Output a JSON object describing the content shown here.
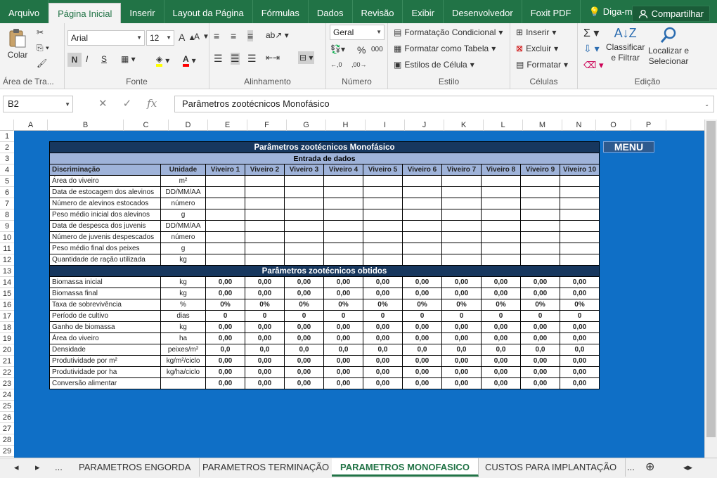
{
  "ribbon_tabs": [
    "Arquivo",
    "Página Inicial",
    "Inserir",
    "Layout da Página",
    "Fórmulas",
    "Dados",
    "Revisão",
    "Exibir",
    "Desenvolvedor",
    "Foxit PDF"
  ],
  "tell_me": "Diga-me...",
  "share": "Compartilhar",
  "clipboard": {
    "paste": "Colar",
    "label": "Área de Tra..."
  },
  "font": {
    "name": "Arial",
    "size": "12",
    "label": "Fonte",
    "bold": "N",
    "italic": "I",
    "underline": "S"
  },
  "alignment": {
    "label": "Alinhamento"
  },
  "number": {
    "format": "Geral",
    "label": "Número",
    "pct": "%",
    "thousands": "000"
  },
  "styles": {
    "cond": "Formatação Condicional",
    "table": "Formatar como Tabela",
    "cell": "Estilos de Célula",
    "label": "Estilo"
  },
  "cells": {
    "insert": "Inserir",
    "delete": "Excluir",
    "format": "Formatar",
    "label": "Células"
  },
  "editing": {
    "sort": "Classificar\ne Filtrar",
    "find": "Localizar e\nSelecionar",
    "label": "Edição"
  },
  "formula_bar": {
    "name_box": "B2",
    "fx": "fx",
    "value": "Parâmetros zootécnicos Monofásico"
  },
  "columns": [
    "A",
    "B",
    "C",
    "D",
    "E",
    "F",
    "G",
    "H",
    "I",
    "J",
    "K",
    "L",
    "M",
    "N",
    "O",
    "P"
  ],
  "rows": [
    "1",
    "2",
    "3",
    "4",
    "5",
    "6",
    "7",
    "8",
    "9",
    "10",
    "11",
    "12",
    "13",
    "14",
    "15",
    "16",
    "17",
    "18",
    "19",
    "20",
    "21",
    "22",
    "23",
    "24",
    "25",
    "26",
    "27",
    "28",
    "29"
  ],
  "sheet": {
    "title": "Parâmetros zootécnicos Monofásico",
    "input_header": "Entrada de dados",
    "col_disc": "Discriminação",
    "col_unit": "Unidade",
    "viveiros": [
      "Viveiro 1",
      "Viveiro 2",
      "Viveiro 3",
      "Viveiro 4",
      "Viveiro 5",
      "Viveiro 6",
      "Viveiro 7",
      "Viveiro 8",
      "Viveiro 9",
      "Viveiro 10"
    ],
    "inputs": [
      {
        "label": "Área do viveiro",
        "unit": "m²"
      },
      {
        "label": "Data de estocagem dos alevinos",
        "unit": "DD/MM/AA"
      },
      {
        "label": "Número de alevinos estocados",
        "unit": "número"
      },
      {
        "label": "Peso médio inicial dos alevinos",
        "unit": "g"
      },
      {
        "label": "Data de despesca dos juvenis",
        "unit": "DD/MM/AA"
      },
      {
        "label": "Número de juvenis despescados",
        "unit": "número"
      },
      {
        "label": "Peso médio final dos peixes",
        "unit": "g"
      },
      {
        "label": "Quantidade de ração utilizada",
        "unit": "kg"
      }
    ],
    "output_header": "Parâmetros zootécnicos obtidos",
    "outputs": [
      {
        "label": "Biomassa inicial",
        "unit": "kg",
        "value": "0,00"
      },
      {
        "label": "Biomassa final",
        "unit": "kg",
        "value": "0,00"
      },
      {
        "label": "Taxa de sobrevivência",
        "unit": "%",
        "value": "0%"
      },
      {
        "label": "Período de cultivo",
        "unit": "dias",
        "value": "0"
      },
      {
        "label": "Ganho de biomassa",
        "unit": "kg",
        "value": "0,00"
      },
      {
        "label": "Área do viveiro",
        "unit": "ha",
        "value": "0,00"
      },
      {
        "label": "Densidade",
        "unit": "peixes/m²",
        "value": "0,0"
      },
      {
        "label": "Produtividade por m²",
        "unit": "kg/m²/ciclo",
        "value": "0,00"
      },
      {
        "label": "Produtividade por ha",
        "unit": "kg/ha/ciclo",
        "value": "0,00"
      },
      {
        "label": "Conversão alimentar",
        "unit": "",
        "value": "0,00"
      }
    ],
    "menu_button": "MENU"
  },
  "sheet_tabs": [
    "PARAMETROS ENGORDA",
    "PARAMETROS TERMINAÇÃO",
    "PARAMETROS MONOFASICO",
    "CUSTOS PARA IMPLANTAÇÃO"
  ],
  "active_sheet_tab": "PARAMETROS MONOFASICO",
  "colors": {
    "ribbon_green": "#217346",
    "sheet_blue": "#0f6fc6",
    "title_navy": "#17375e",
    "header_blue": "#9fb3d9"
  }
}
